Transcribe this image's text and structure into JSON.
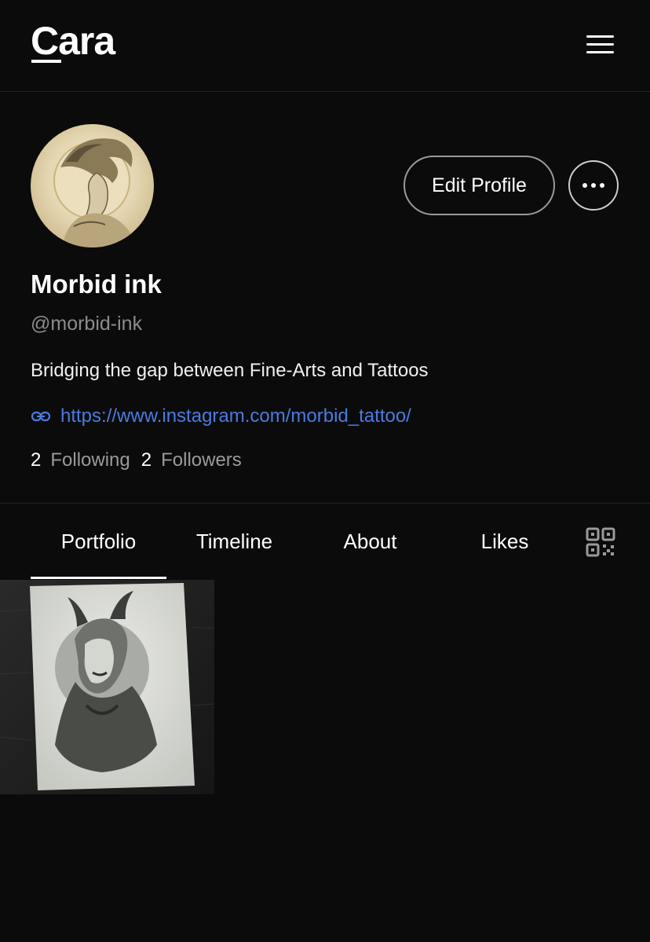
{
  "header": {
    "logo": "Cara",
    "menu_icon": "hamburger-menu-icon"
  },
  "profile": {
    "avatar_icon": "profile-avatar",
    "edit_label": "Edit Profile",
    "more_icon": "more-options-icon",
    "display_name": "Morbid ink",
    "handle": "@morbid-ink",
    "bio": "Bridging the gap between Fine-Arts and Tattoos",
    "link": "https://www.instagram.com/morbid_tattoo/",
    "link_icon": "link-icon",
    "following_count": "2",
    "following_label": "Following",
    "followers_count": "2",
    "followers_label": "Followers"
  },
  "tabs": [
    {
      "label": "Portfolio",
      "active": true
    },
    {
      "label": "Timeline",
      "active": false
    },
    {
      "label": "About",
      "active": false
    },
    {
      "label": "Likes",
      "active": false
    }
  ],
  "qr_icon": "qr-code-icon",
  "portfolio": {
    "items": [
      {
        "type": "artwork"
      }
    ]
  },
  "colors": {
    "background": "#0b0b0b",
    "link": "#4a7be0",
    "muted": "#8c8c8c"
  }
}
